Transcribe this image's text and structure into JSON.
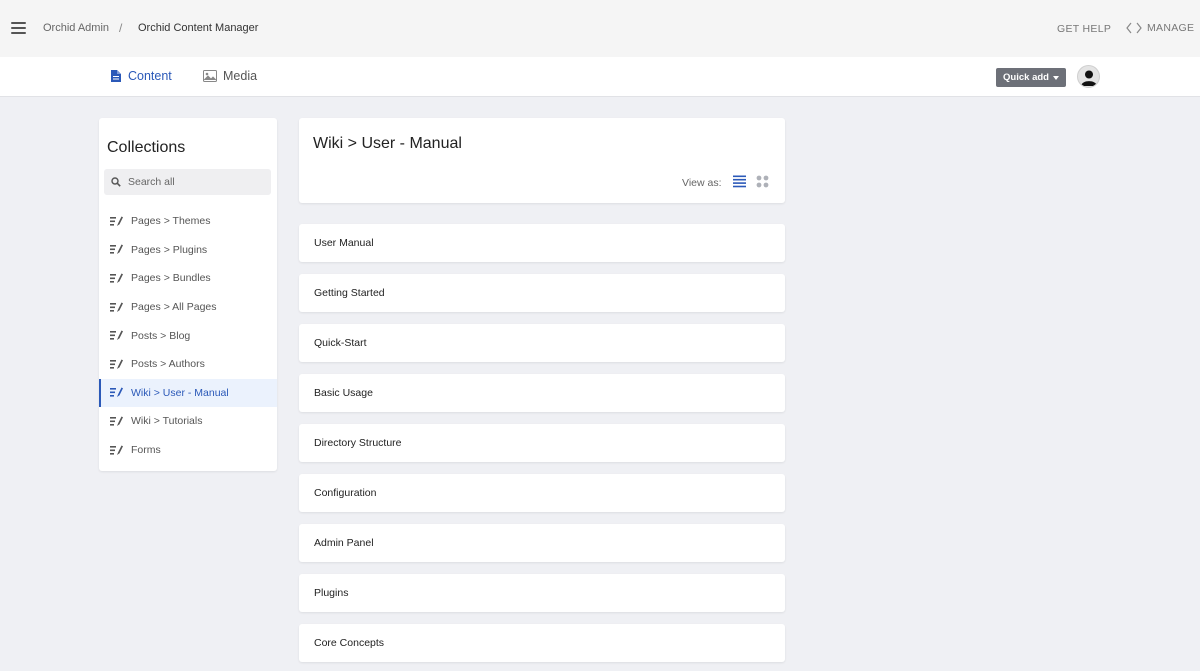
{
  "topbar": {
    "breadcrumb_root": "Orchid Admin",
    "breadcrumb_separator": "/",
    "breadcrumb_current": "Orchid Content Manager",
    "get_help": "GET HELP",
    "manage": "MANAGE"
  },
  "navbar": {
    "tabs": [
      {
        "label": "Content",
        "icon": "document-icon",
        "active": true
      },
      {
        "label": "Media",
        "icon": "image-icon",
        "active": false
      }
    ],
    "quick_add": "Quick add"
  },
  "sidebar": {
    "title": "Collections",
    "search_placeholder": "Search all",
    "items": [
      {
        "label": "Pages > Themes",
        "active": false
      },
      {
        "label": "Pages > Plugins",
        "active": false
      },
      {
        "label": "Pages > Bundles",
        "active": false
      },
      {
        "label": "Pages > All Pages",
        "active": false
      },
      {
        "label": "Posts > Blog",
        "active": false
      },
      {
        "label": "Posts > Authors",
        "active": false
      },
      {
        "label": "Wiki > User - Manual",
        "active": true
      },
      {
        "label": "Wiki > Tutorials",
        "active": false
      },
      {
        "label": "Forms",
        "active": false
      }
    ]
  },
  "main": {
    "title": "Wiki > User - Manual",
    "view_as": "View as:",
    "entries": [
      "User Manual",
      "Getting Started",
      "Quick-Start",
      "Basic Usage",
      "Directory Structure",
      "Configuration",
      "Admin Panel",
      "Plugins",
      "Core Concepts"
    ]
  },
  "colors": {
    "accent": "#2b59b8",
    "active_bg": "#ebf2fd",
    "page_bg": "#eff0f4",
    "button_gray": "#6d7078"
  }
}
